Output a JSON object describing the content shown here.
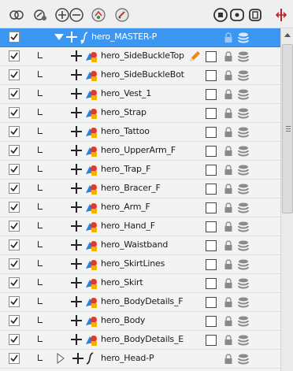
{
  "toolbar": {
    "buttons": [
      {
        "name": "show-all-icon"
      },
      {
        "name": "hide-all-icon"
      },
      {
        "name": "add-layer-icon"
      },
      {
        "name": "delete-layer-icon"
      },
      {
        "name": "add-peg-icon"
      },
      {
        "name": "add-drawing-layer-icon"
      },
      {
        "name": "layer-properties-icon"
      },
      {
        "name": "show-thumbnails-icon"
      },
      {
        "name": "toggle-columns-icon"
      },
      {
        "name": "split-view-icon"
      }
    ]
  },
  "layers": {
    "master": {
      "name": "hero_MASTER-P",
      "checked": true
    },
    "rows": [
      {
        "name": "hero_SideBuckleTop",
        "checked": true,
        "pencil": true
      },
      {
        "name": "hero_SideBuckleBot",
        "checked": true
      },
      {
        "name": "hero_Vest_1",
        "checked": true
      },
      {
        "name": "hero_Strap",
        "checked": true
      },
      {
        "name": "hero_Tattoo",
        "checked": true
      },
      {
        "name": "hero_UpperArm_F",
        "checked": true
      },
      {
        "name": "hero_Trap_F",
        "checked": true
      },
      {
        "name": "hero_Bracer_F",
        "checked": true
      },
      {
        "name": "hero_Arm_F",
        "checked": true
      },
      {
        "name": "hero_Hand_F",
        "checked": true
      },
      {
        "name": "hero_Waistband",
        "checked": true
      },
      {
        "name": "hero_SkirtLines",
        "checked": true
      },
      {
        "name": "hero_Skirt",
        "checked": true
      },
      {
        "name": "hero_BodyDetails_F",
        "checked": true
      },
      {
        "name": "hero_Body",
        "checked": true
      },
      {
        "name": "hero_BodyDetails_E",
        "checked": true
      }
    ],
    "last": {
      "name": "hero_Head-P",
      "checked": true
    }
  },
  "colors": {
    "selection": "#3b97f1",
    "row_bg": "#f3f3f3"
  }
}
